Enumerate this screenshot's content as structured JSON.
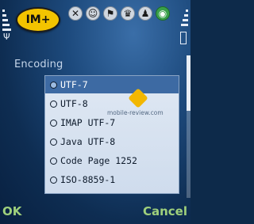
{
  "status": {
    "logo_text": "IM+",
    "icons": [
      "status-away-icon",
      "status-smile-icon",
      "status-run-icon",
      "status-trophy-icon",
      "status-user-icon",
      "status-eye-icon"
    ]
  },
  "dialog": {
    "title": "Encoding",
    "selected_index": 0,
    "options": [
      "UTF-7",
      "UTF-8",
      "IMAP UTF-7",
      "Java UTF-8",
      "Code Page 1252",
      "ISO-8859-1"
    ]
  },
  "softkeys": {
    "left": "OK",
    "right": "Cancel"
  },
  "watermark": "mobile-review.com",
  "colors": {
    "accent": "#3d6aa3",
    "softkey": "#9fd07c",
    "logo": "#f3c400"
  }
}
